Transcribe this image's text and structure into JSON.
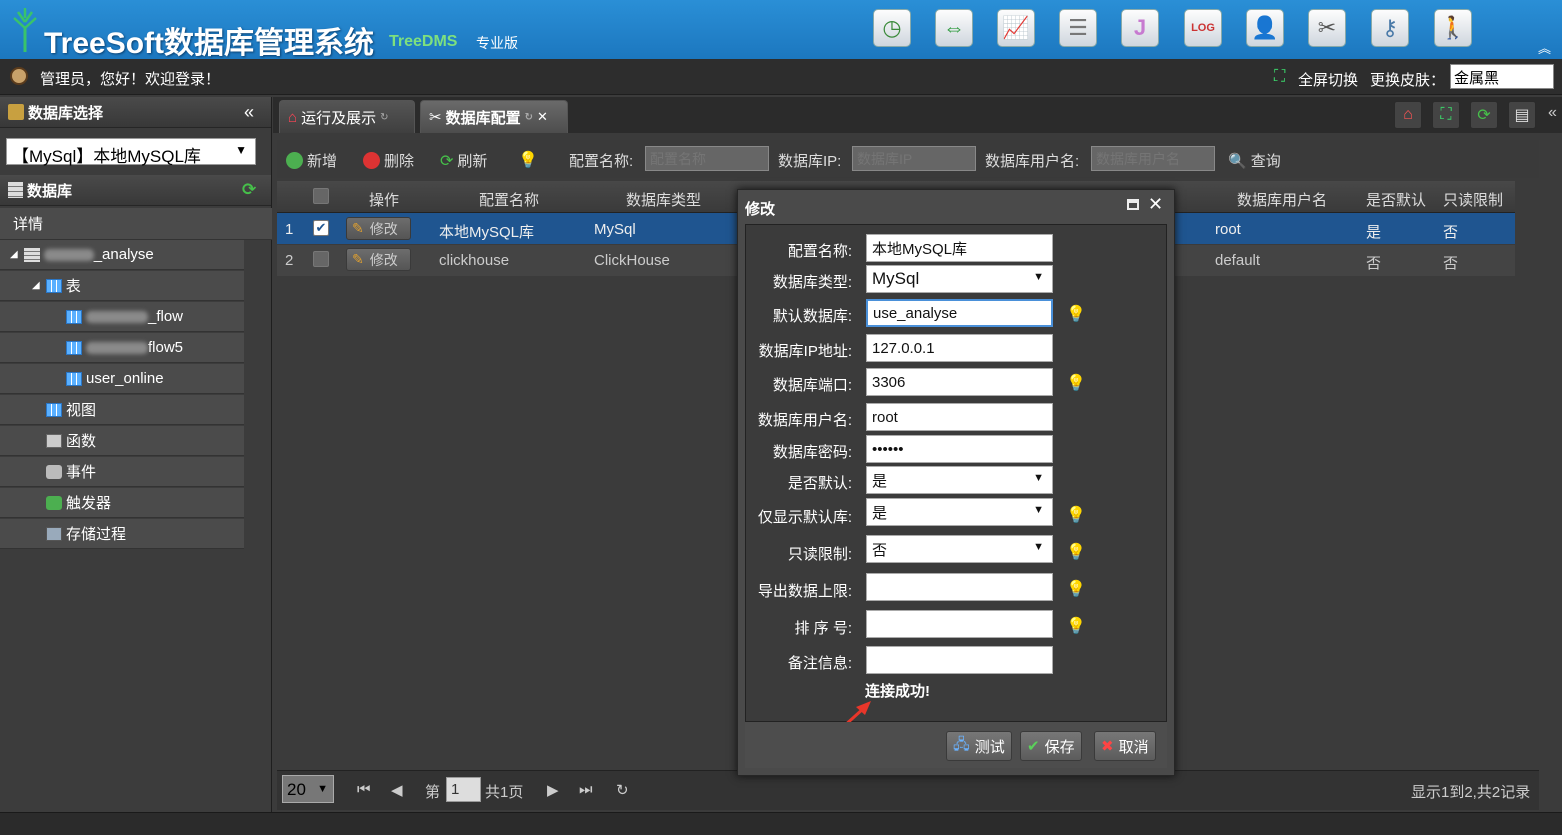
{
  "header": {
    "title": "TreeSoft数据库管理系统",
    "subtitle": "TreeDMS",
    "edition": "专业版",
    "icons": [
      "clock-icon",
      "sync-icon",
      "chart-icon",
      "database-icon",
      "j-icon",
      "log-icon",
      "user-manager-icon",
      "tools-icon",
      "key-icon",
      "person-walk-icon"
    ]
  },
  "userbar": {
    "welcome": "管理员，您好！欢迎登录！",
    "fullscreen": "全屏切换",
    "skin_label": "更换皮肤：",
    "skin_value": "金属黑"
  },
  "left": {
    "db_select_title": "数据库选择",
    "db_selected": "【MySql】本地MySQL库",
    "db_title": "数据库",
    "detail": "详情",
    "tree": {
      "db_suffix": "_analyse",
      "tables_label": "表",
      "table1_suffix": "_flow",
      "table2_suffix": "flow5",
      "table3": "user_online",
      "views": "视图",
      "functions": "函数",
      "events": "事件",
      "triggers": "触发器",
      "procedures": "存储过程"
    }
  },
  "tabs": [
    {
      "label": "运行及展示"
    },
    {
      "label": "数据库配置"
    }
  ],
  "toolbar": {
    "add": "新增",
    "delete": "删除",
    "refresh": "刷新",
    "config_name_label": "配置名称:",
    "config_name_placeholder": "配置名称",
    "ip_label": "数据库IP:",
    "ip_placeholder": "数据库IP",
    "user_label": "数据库用户名:",
    "user_placeholder": "数据库用户名",
    "query": "查询"
  },
  "grid": {
    "headers": {
      "op": "操作",
      "name": "配置名称",
      "type": "数据库类型",
      "user": "数据库用户名",
      "default": "是否默认",
      "readonly": "只读限制"
    },
    "edit_label": "修改",
    "rows": [
      {
        "num": "1",
        "name": "本地MySQL库",
        "type": "MySql",
        "user": "root",
        "default": "是",
        "readonly": "否"
      },
      {
        "num": "2",
        "name": "clickhouse",
        "type": "ClickHouse",
        "user": "default",
        "default": "否",
        "readonly": "否"
      }
    ]
  },
  "pager": {
    "page_size": "20",
    "page_prefix": "第",
    "page": "1",
    "page_total": "共1页",
    "summary": "显示1到2,共2记录"
  },
  "modal": {
    "title": "修改",
    "fields": {
      "name_label": "配置名称:",
      "name": "本地MySQL库",
      "type_label": "数据库类型:",
      "type": "MySql",
      "dbname_label": "默认数据库:",
      "dbname": "use_analyse",
      "ip_label": "数据库IP地址:",
      "ip": "127.0.0.1",
      "port_label": "数据库端口:",
      "port": "3306",
      "user_label": "数据库用户名:",
      "user": "root",
      "pwd_label": "数据库密码:",
      "pwd": "••••••",
      "default_label": "是否默认:",
      "default": "是",
      "onlydefault_label": "仅显示默认库:",
      "onlydefault": "是",
      "readonly_label": "只读限制:",
      "readonly": "否",
      "export_label": "导出数据上限:",
      "export": "",
      "order_label": "排 序 号:",
      "order": "",
      "remark_label": "备注信息:",
      "remark": ""
    },
    "message": "连接成功!",
    "test": "测试",
    "save": "保存",
    "cancel": "取消"
  },
  "colors": {
    "header": "#1c77bf",
    "selected_row": "#1f5590",
    "success_arrow": "#e8362a"
  }
}
